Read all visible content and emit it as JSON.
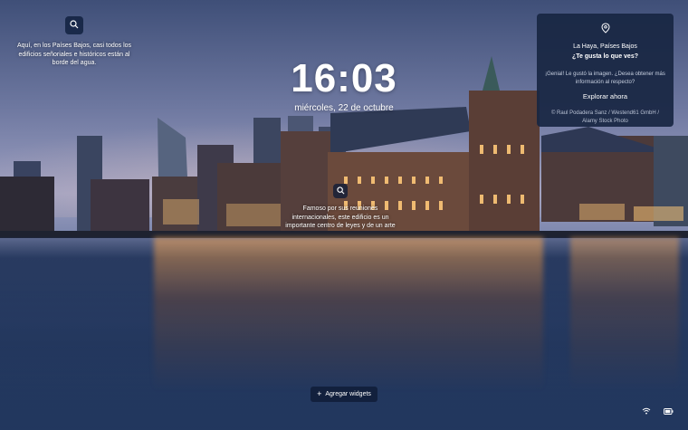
{
  "background": {
    "hotspot_left": {
      "text": "Aquí, en los Países Bajos, casi todos los edificios señoriales e históricos están al borde del agua."
    },
    "hotspot_center": {
      "text": "Famoso por sus reuniones internacionales, este edificio es un importante centro de leyes y de un arte"
    }
  },
  "clock": {
    "time": "16:03",
    "date": "miércoles, 22 de octubre"
  },
  "spotlight_card": {
    "location": "La Haya, Países Bajos",
    "question": "¿Te gusta lo que ves?",
    "liked_text": "¡Genial! Le gustó la imagen. ¿Desea obtener más información al respecto?",
    "explore_label": "Explorar ahora",
    "credit": "© Raul Podadera Sanz / Westend61 GmbH / Alamy Stock Photo"
  },
  "widgets": {
    "add_label": "Agregar widgets"
  },
  "icons": {
    "hotspot": "search-icon",
    "location": "location-pin-icon",
    "add": "plus-icon",
    "network": "wifi-icon",
    "battery": "battery-icon"
  }
}
